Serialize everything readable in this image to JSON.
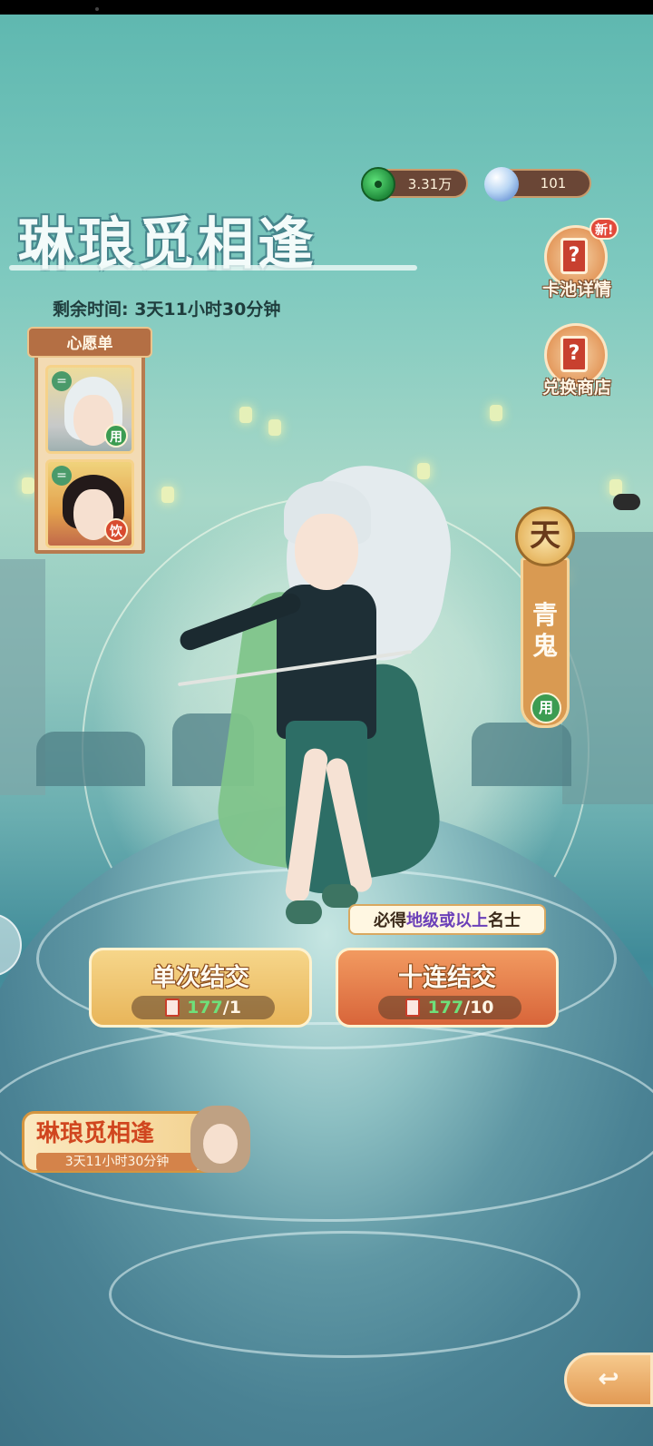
{
  "event": {
    "title": "琳琅觅相逢",
    "timer": "剩余时间: 3天11小时30分钟"
  },
  "currency": {
    "jade": {
      "icon": "jade-coin-icon",
      "amount": "3.31万"
    },
    "pearl": {
      "icon": "pearl-icon",
      "amount": "101"
    }
  },
  "side_buttons": {
    "pool_details": {
      "label": "卡池详情",
      "badge": "新!",
      "icon": "card-question-icon",
      "glyph": "?"
    },
    "exchange_shop": {
      "label": "兑换商店",
      "icon": "card-question-icon",
      "glyph": "?"
    }
  },
  "wishlist": {
    "title": "心愿单",
    "items": [
      {
        "rank_icon": "=",
        "tag": "用",
        "portrait": "white-hair-lady"
      },
      {
        "rank_icon": "=",
        "tag": "饮",
        "portrait": "black-hair-lady"
      }
    ]
  },
  "character": {
    "grade": "天",
    "name": "青鬼",
    "tag": "用"
  },
  "guarantee_hint": {
    "prefix": "必得",
    "highlight": "地级或以上",
    "suffix": "名士"
  },
  "pulls": {
    "single": {
      "label": "单次结交",
      "have": "177",
      "need": "/1"
    },
    "ten": {
      "label": "十连结交",
      "have": "177",
      "need": "/10"
    }
  },
  "event_banner": {
    "title": "琳琅觅相逢",
    "time": "3天11小时30分钟"
  },
  "back_button": {
    "icon": "return-arrow-icon",
    "glyph": "↩"
  },
  "colors": {
    "accent_orange": "#d8653a",
    "accent_gold": "#e8b55a",
    "highlight_purple": "#6a3fb8",
    "cost_green": "#6fe07a"
  }
}
